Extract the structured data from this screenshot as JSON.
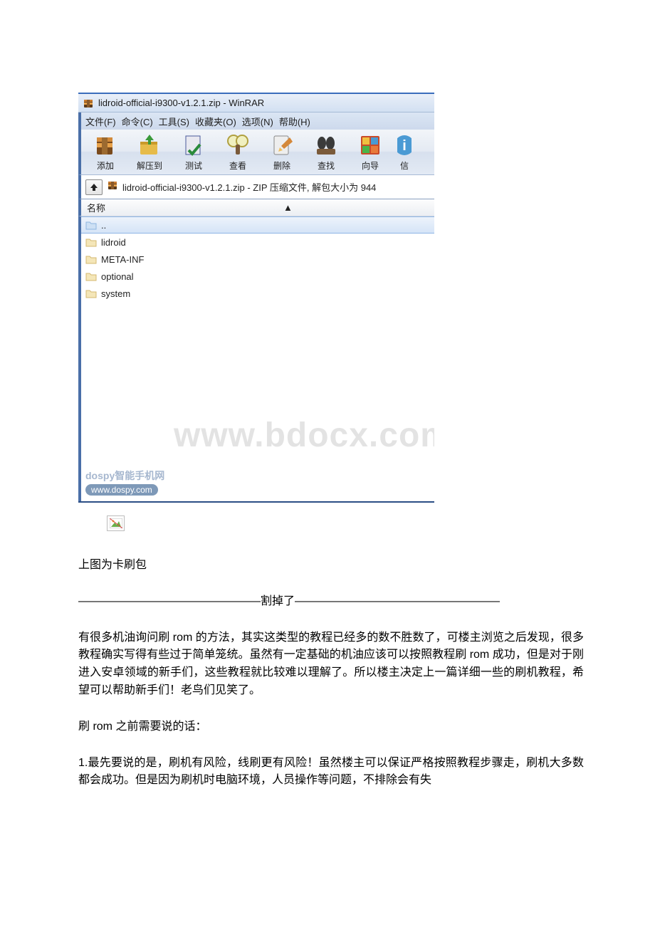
{
  "winrar": {
    "title": "lidroid-official-i9300-v1.2.1.zip - WinRAR",
    "menu": {
      "file": "文件(F)",
      "command": "命令(C)",
      "tools": "工具(S)",
      "favorites": "收藏夹(O)",
      "options": "选项(N)",
      "help": "帮助(H)"
    },
    "toolbar": {
      "add": "添加",
      "extract": "解压到",
      "test": "测试",
      "view": "查看",
      "delete": "删除",
      "find": "查找",
      "wizard": "向导",
      "info": "信"
    },
    "path": "lidroid-official-i9300-v1.2.1.zip - ZIP 压缩文件, 解包大小为 944",
    "col_name": "名称",
    "files": {
      "parent": "..",
      "f1": "lidroid",
      "f2": "META-INF",
      "f3": "optional",
      "f4": "system"
    },
    "watermark": "www.bdocx.com",
    "wm_brand": "dospy智能手机网",
    "wm_url": "www.dospy.com"
  },
  "text": {
    "caption": "上图为卡刷包",
    "separator": "————————————————割掉了——————————————————",
    "p1": "有很多机油询问刷 rom 的方法，其实这类型的教程已经多的数不胜数了，可楼主浏览之后发现，很多教程确实写得有些过于简单笼统。虽然有一定基础的机油应该可以按照教程刷 rom 成功，但是对于刚进入安卓领域的新手们，这些教程就比较难以理解了。所以楼主决定上一篇详细一些的刷机教程，希望可以帮助新手们！老鸟们见笑了。",
    "p2": "刷 rom 之前需要说的话：",
    "p3": "1.最先要说的是，刷机有风险，线刷更有风险！虽然楼主可以保证严格按照教程步骤走，刷机大多数都会成功。但是因为刷机时电脑环境，人员操作等问题，不排除会有失"
  }
}
